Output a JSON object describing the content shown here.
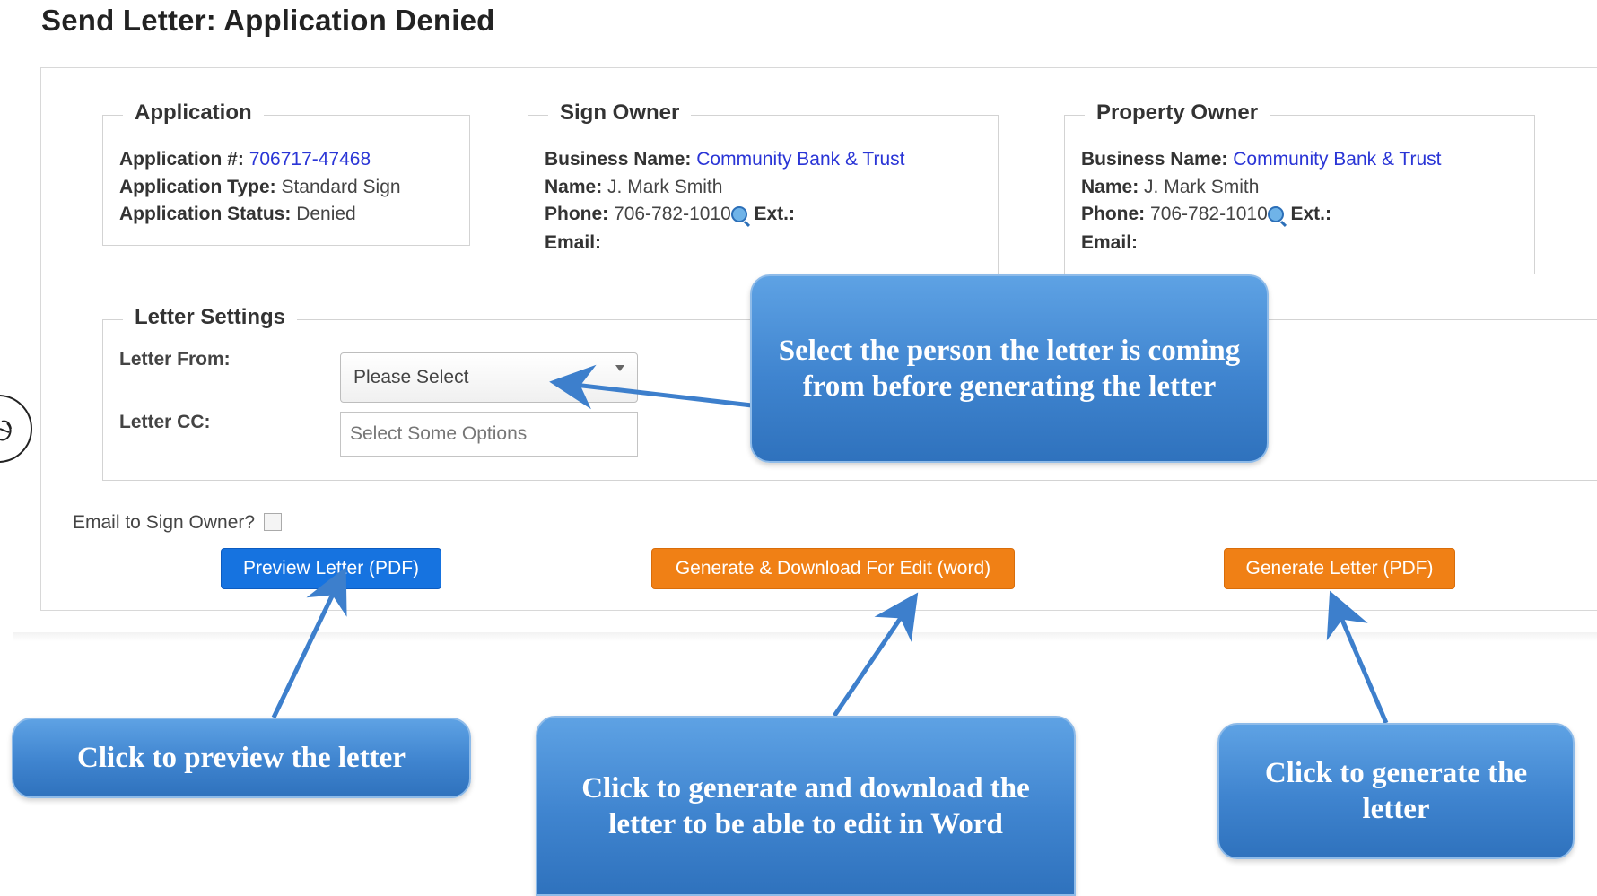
{
  "page": {
    "title": "Send Letter: Application Denied"
  },
  "application": {
    "legend": "Application",
    "number_label": "Application #:",
    "number": "706717-47468",
    "type_label": "Application Type:",
    "type": "Standard Sign",
    "status_label": "Application Status:",
    "status": "Denied"
  },
  "sign_owner": {
    "legend": "Sign Owner",
    "business_label": "Business Name:",
    "business": "Community Bank & Trust",
    "name_label": "Name:",
    "name": "J. Mark Smith",
    "phone_label": "Phone:",
    "phone": "706-782-1010",
    "ext_label": "Ext.:",
    "email_label": "Email:"
  },
  "property_owner": {
    "legend": "Property Owner",
    "business_label": "Business Name:",
    "business": "Community Bank & Trust",
    "name_label": "Name:",
    "name": "J. Mark Smith",
    "phone_label": "Phone:",
    "phone": "706-782-1010",
    "ext_label": "Ext.:",
    "email_label": "Email:"
  },
  "letter_settings": {
    "legend": "Letter Settings",
    "from_label": "Letter From:",
    "from_value": "Please Select",
    "cc_label": "Letter CC:",
    "cc_placeholder": "Select Some Options"
  },
  "email_option": {
    "label": "Email to Sign Owner?",
    "checked": false
  },
  "buttons": {
    "preview": "Preview Letter (PDF)",
    "generate_word": "Generate & Download For Edit (word)",
    "generate_pdf": "Generate Letter (PDF)"
  },
  "callouts": {
    "letter_from": "Select the person the letter is coming from before generating the letter",
    "preview": "Click to preview the letter",
    "generate_word": "Click to generate and download the letter to be able to edit in Word",
    "generate_pdf": "Click to generate the letter"
  },
  "colors": {
    "link": "#2a35d6",
    "primary_button": "#1673e0",
    "warning_button": "#f08015",
    "callout": "#4a8fd8"
  },
  "icons": {
    "phone": "phone-lookup-icon",
    "dropdown": "chevron-down-icon",
    "side_widget": "hand-cursor-icon"
  }
}
